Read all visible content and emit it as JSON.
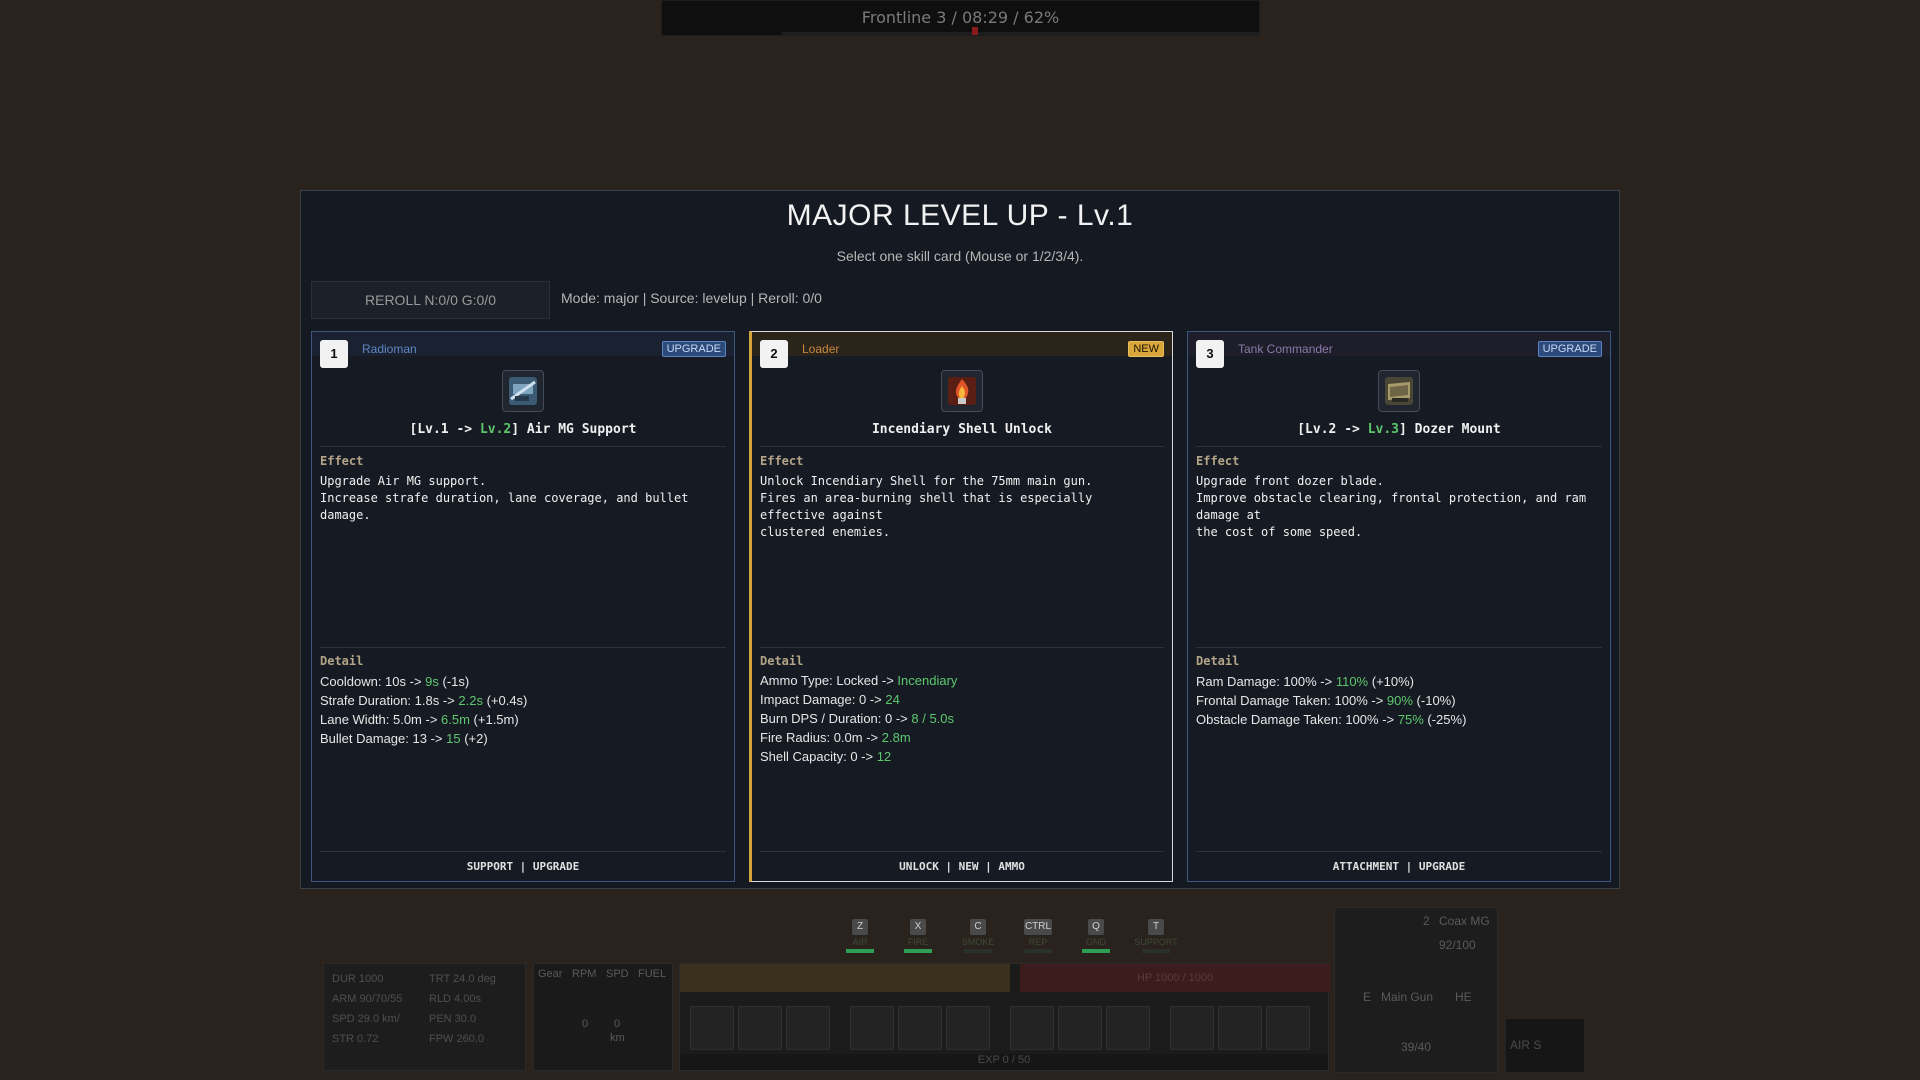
{
  "hud_top": {
    "status": "Frontline 3 / 08:29 / 62%"
  },
  "modal": {
    "title": "MAJOR LEVEL UP - Lv.1",
    "subtitle": "Select one skill card (Mouse or 1/2/3/4).",
    "reroll_label": "REROLL N:0/0 G:0/0",
    "mode_text": "Mode: major | Source: levelup | Reroll: 0/0"
  },
  "cards": [
    {
      "number": "1",
      "role": "Radioman",
      "tag": "UPGRADE",
      "icon": "radio-mg-icon",
      "title_prefix": "[Lv.1 -> ",
      "title_level": "Lv.2",
      "title_suffix": "] Air MG Support",
      "effect_label": "Effect",
      "effect_lines": [
        "Upgrade Air MG support.",
        "Increase strafe duration, lane coverage, and bullet damage."
      ],
      "detail_label": "Detail",
      "details": [
        {
          "label": "Cooldown: 10s -> ",
          "value": "9s",
          "delta": " (-1s)"
        },
        {
          "label": "Strafe Duration: 1.8s -> ",
          "value": "2.2s",
          "delta": " (+0.4s)"
        },
        {
          "label": "Lane Width: 5.0m -> ",
          "value": "6.5m",
          "delta": " (+1.5m)"
        },
        {
          "label": "Bullet Damage: 13 -> ",
          "value": "15",
          "delta": " (+2)"
        }
      ],
      "footer": "SUPPORT | UPGRADE"
    },
    {
      "number": "2",
      "role": "Loader",
      "tag": "NEW",
      "icon": "incendiary-shell-icon",
      "title_prefix": "",
      "title_level": "",
      "title_suffix": "Incendiary Shell Unlock",
      "effect_label": "Effect",
      "effect_lines": [
        "Unlock Incendiary Shell for the 75mm main gun.",
        "Fires an area-burning shell that is especially effective against",
        "clustered enemies."
      ],
      "detail_label": "Detail",
      "details": [
        {
          "label": "Ammo Type: Locked -> ",
          "value": "Incendiary",
          "delta": ""
        },
        {
          "label": "Impact Damage: 0 -> ",
          "value": "24",
          "delta": ""
        },
        {
          "label": "Burn DPS / Duration: 0 -> ",
          "value": "8 / 5.0s",
          "delta": ""
        },
        {
          "label": "Fire Radius: 0.0m -> ",
          "value": "2.8m",
          "delta": ""
        },
        {
          "label": "Shell Capacity: 0 -> ",
          "value": "12",
          "delta": ""
        }
      ],
      "footer": "UNLOCK | NEW | AMMO"
    },
    {
      "number": "3",
      "role": "Tank Commander",
      "tag": "UPGRADE",
      "icon": "dozer-blade-icon",
      "title_prefix": "[Lv.2 -> ",
      "title_level": "Lv.3",
      "title_suffix": "] Dozer Mount",
      "effect_label": "Effect",
      "effect_lines": [
        "Upgrade front dozer blade.",
        "Improve obstacle clearing, frontal protection, and ram damage at",
        "the cost of some speed."
      ],
      "detail_label": "Detail",
      "details": [
        {
          "label": "Ram Damage: 100% -> ",
          "value": "110%",
          "delta": " (+10%)"
        },
        {
          "label": "Frontal Damage Taken: 100% -> ",
          "value": "90%",
          "delta": " (-10%)"
        },
        {
          "label": "Obstacle Damage Taken: 100% -> ",
          "value": "75%",
          "delta": " (-25%)"
        }
      ],
      "footer": "ATTACHMENT | UPGRADE"
    }
  ],
  "hud_keys": [
    {
      "key": "Z",
      "label": "AIR",
      "active": true
    },
    {
      "key": "X",
      "label": "FIRE",
      "active": true
    },
    {
      "key": "C",
      "label": "SMOKE",
      "active": false
    },
    {
      "key": "CTRL",
      "label": "REP",
      "active": false
    },
    {
      "key": "Q",
      "label": "GND",
      "active": true
    },
    {
      "key": "T",
      "label": "SUPPORT",
      "active": false
    }
  ],
  "hud_stats": {
    "left": [
      "DUR 1000",
      "ARM 90/70/55",
      "SPD 29.0 km/",
      "STR 0.72"
    ],
    "right": [
      "TRT 24.0 deg",
      "RLD 4.00s",
      "PEN 30.0",
      "FPW 260.0"
    ]
  },
  "hud_gauges": [
    "Gear",
    "RPM",
    "SPD",
    "FUEL"
  ],
  "hud_gauge_values": {
    "rpm": "0",
    "spd": "0",
    "spd_unit": "km"
  },
  "hud_hp": "HP 1000 / 1000",
  "hud_exp": "EXP 0 / 50",
  "hud_weapon": {
    "coax_key": "2",
    "coax_label": "Coax MG",
    "coax_ammo": "92/100",
    "main_key": "E",
    "main_label": "Main Gun",
    "main_ammo_type": "HE",
    "main_ammo": "39/40"
  },
  "hud_air": "AIR S"
}
